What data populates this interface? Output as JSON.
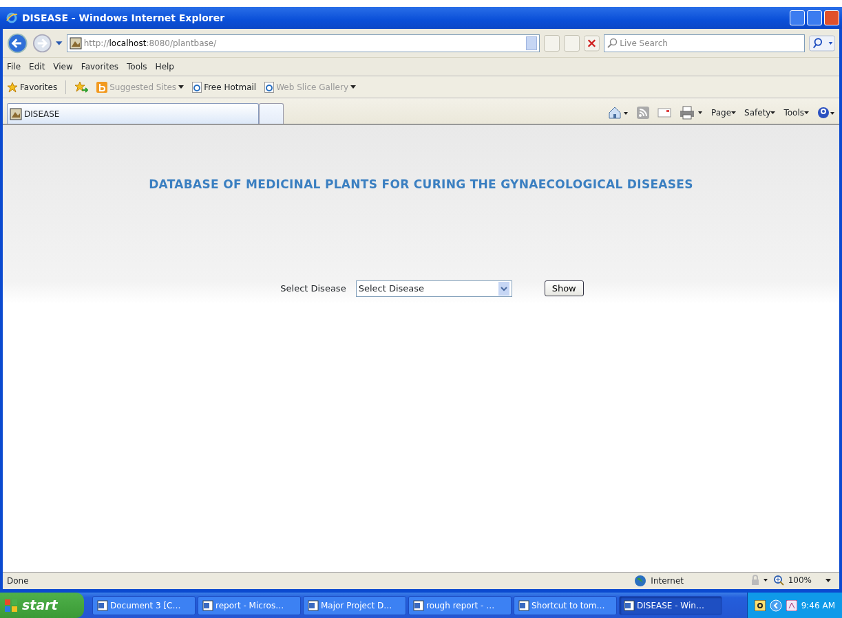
{
  "window": {
    "title": "DISEASE - Windows Internet Explorer"
  },
  "address_bar": {
    "url": "http://**localhost**:8080/plantbase/"
  },
  "search": {
    "placeholder": "Live Search"
  },
  "menu": [
    "File",
    "Edit",
    "View",
    "Favorites",
    "Tools",
    "Help"
  ],
  "favorites_bar": [
    {
      "kind": "star",
      "label": "Favorites",
      "disabled": false,
      "dropdown": false
    },
    {
      "kind": "bing",
      "label": "Suggested Sites",
      "disabled": true,
      "dropdown": true
    },
    {
      "kind": "ie",
      "label": "Free Hotmail",
      "disabled": false,
      "dropdown": false
    },
    {
      "kind": "ie",
      "label": "Web Slice Gallery",
      "disabled": true,
      "dropdown": true
    }
  ],
  "tabs": [
    {
      "label": "DISEASE",
      "selected": true
    }
  ],
  "command_bar": [
    "Page",
    "Safety",
    "Tools"
  ],
  "page": {
    "heading": "DATABASE OF MEDICINAL PLANTS FOR CURING THE GYNAECOLOGICAL DISEASES",
    "label": "Select Disease",
    "select_value": "Select Disease",
    "button": "Show"
  },
  "status_bar": {
    "text": "Done",
    "zone": "Internet",
    "zoom": "100%"
  },
  "taskbar": {
    "start": "start",
    "items": [
      {
        "label": "Document 3 [C…",
        "selected": false
      },
      {
        "label": "report - Micros…",
        "selected": false
      },
      {
        "label": "Major Project D…",
        "selected": false
      },
      {
        "label": "rough report - …",
        "selected": false
      },
      {
        "label": "Shortcut to tom…",
        "selected": false
      },
      {
        "label": "DISEASE - Win…",
        "selected": true
      }
    ],
    "clock": "9:46 AM"
  }
}
